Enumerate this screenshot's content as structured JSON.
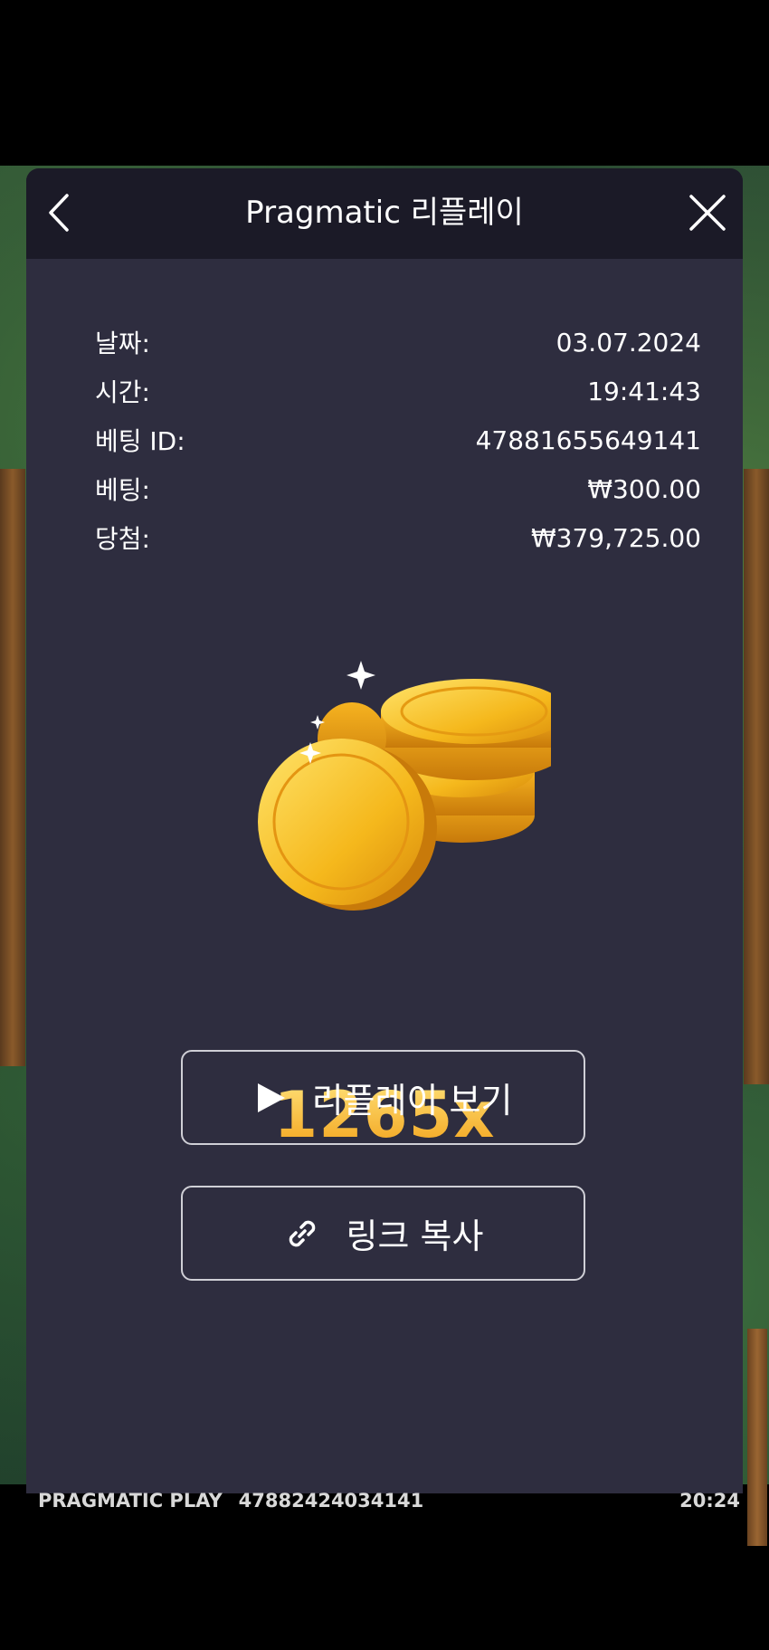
{
  "header": {
    "title": "Pragmatic 리플레이",
    "back_icon": "chevron-left-icon",
    "close_icon": "close-icon"
  },
  "info": {
    "rows": [
      {
        "label": "날짜:",
        "value": "03.07.2024"
      },
      {
        "label": "시간:",
        "value": "19:41:43"
      },
      {
        "label": "베팅 ID:",
        "value": "47881655649141"
      },
      {
        "label": "베팅:",
        "value": "₩300.00"
      },
      {
        "label": "당첨:",
        "value": "₩379,725.00"
      }
    ]
  },
  "result": {
    "multiplier": "1265x",
    "image_icon": "gold-coins-icon"
  },
  "actions": {
    "replay_label": "리플레이 보기",
    "replay_icon": "play-icon",
    "copy_link_label": "링크 복사",
    "copy_link_icon": "link-icon"
  },
  "footer": {
    "brand": "PRAGMATIC PLAY",
    "round_id": "47882424034141",
    "clock": "20:24"
  },
  "colors": {
    "modal_bg": "#2e2d3f",
    "header_bg": "#1b1a27",
    "accent_gold": "#f5b423"
  }
}
